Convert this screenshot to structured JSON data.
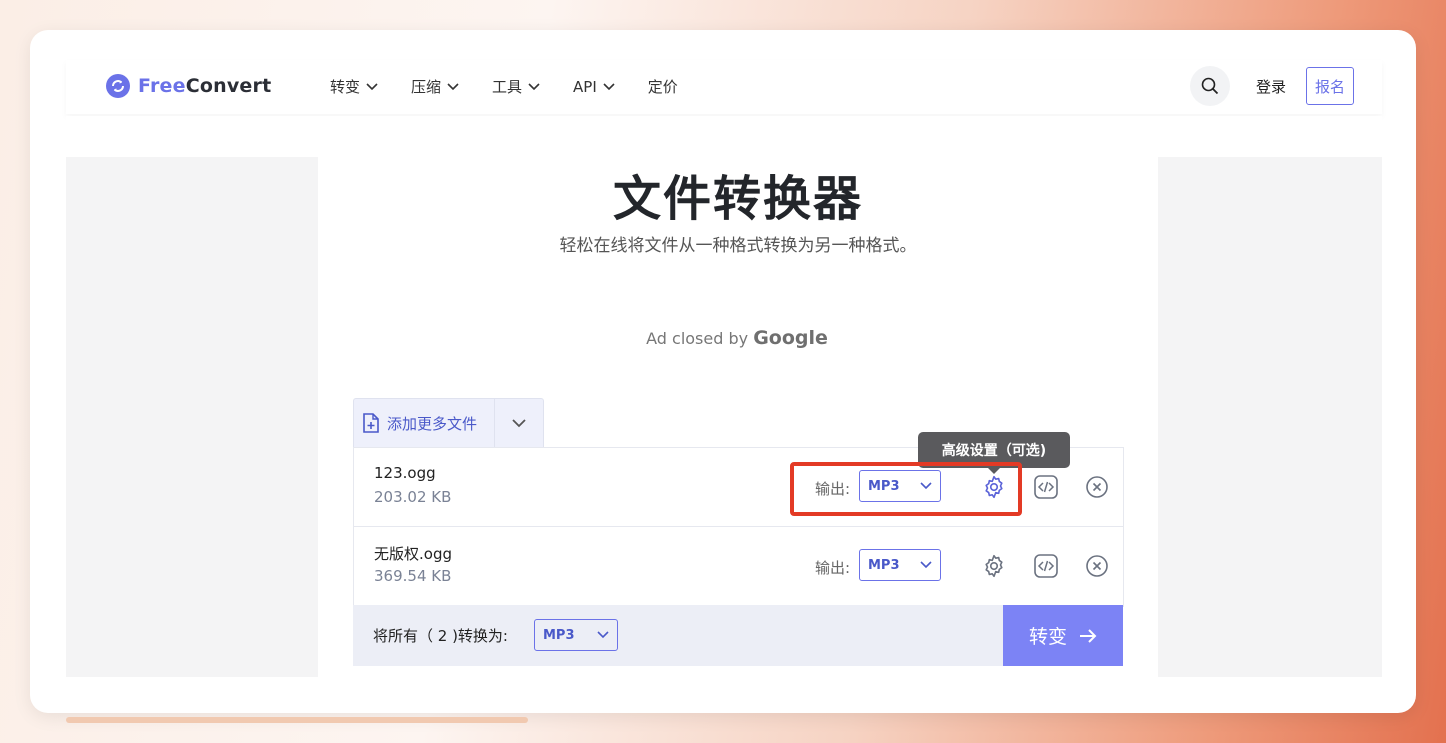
{
  "brand": {
    "free": "Free",
    "convert": "Convert"
  },
  "nav": {
    "items": [
      {
        "label": "转变",
        "has_dropdown": true
      },
      {
        "label": "压缩",
        "has_dropdown": true
      },
      {
        "label": "工具",
        "has_dropdown": true
      },
      {
        "label": "API",
        "has_dropdown": true
      },
      {
        "label": "定价",
        "has_dropdown": false
      }
    ],
    "login": "登录",
    "signup": "报名"
  },
  "hero": {
    "title": "文件转换器",
    "subtitle": "轻松在线将文件从一种格式转换为另一种格式。"
  },
  "ad": {
    "text": "Ad closed by ",
    "brand": "Google"
  },
  "upload": {
    "add_more_label": "添加更多文件"
  },
  "files": [
    {
      "name": "123.ogg",
      "size": "203.02 KB",
      "output_label": "输出:",
      "format": "MP3"
    },
    {
      "name": "无版权.ogg",
      "size": "369.54 KB",
      "output_label": "输出:",
      "format": "MP3"
    }
  ],
  "batch": {
    "label": "将所有（ 2 )转换为:",
    "format": "MP3",
    "convert_label": "转变"
  },
  "tooltip": {
    "text": "高级设置（可选)"
  },
  "colors": {
    "accent": "#6b72e8",
    "convert_button": "#7c83f5",
    "highlight": "#e33a25",
    "tooltip_bg": "#5a5a5d"
  }
}
